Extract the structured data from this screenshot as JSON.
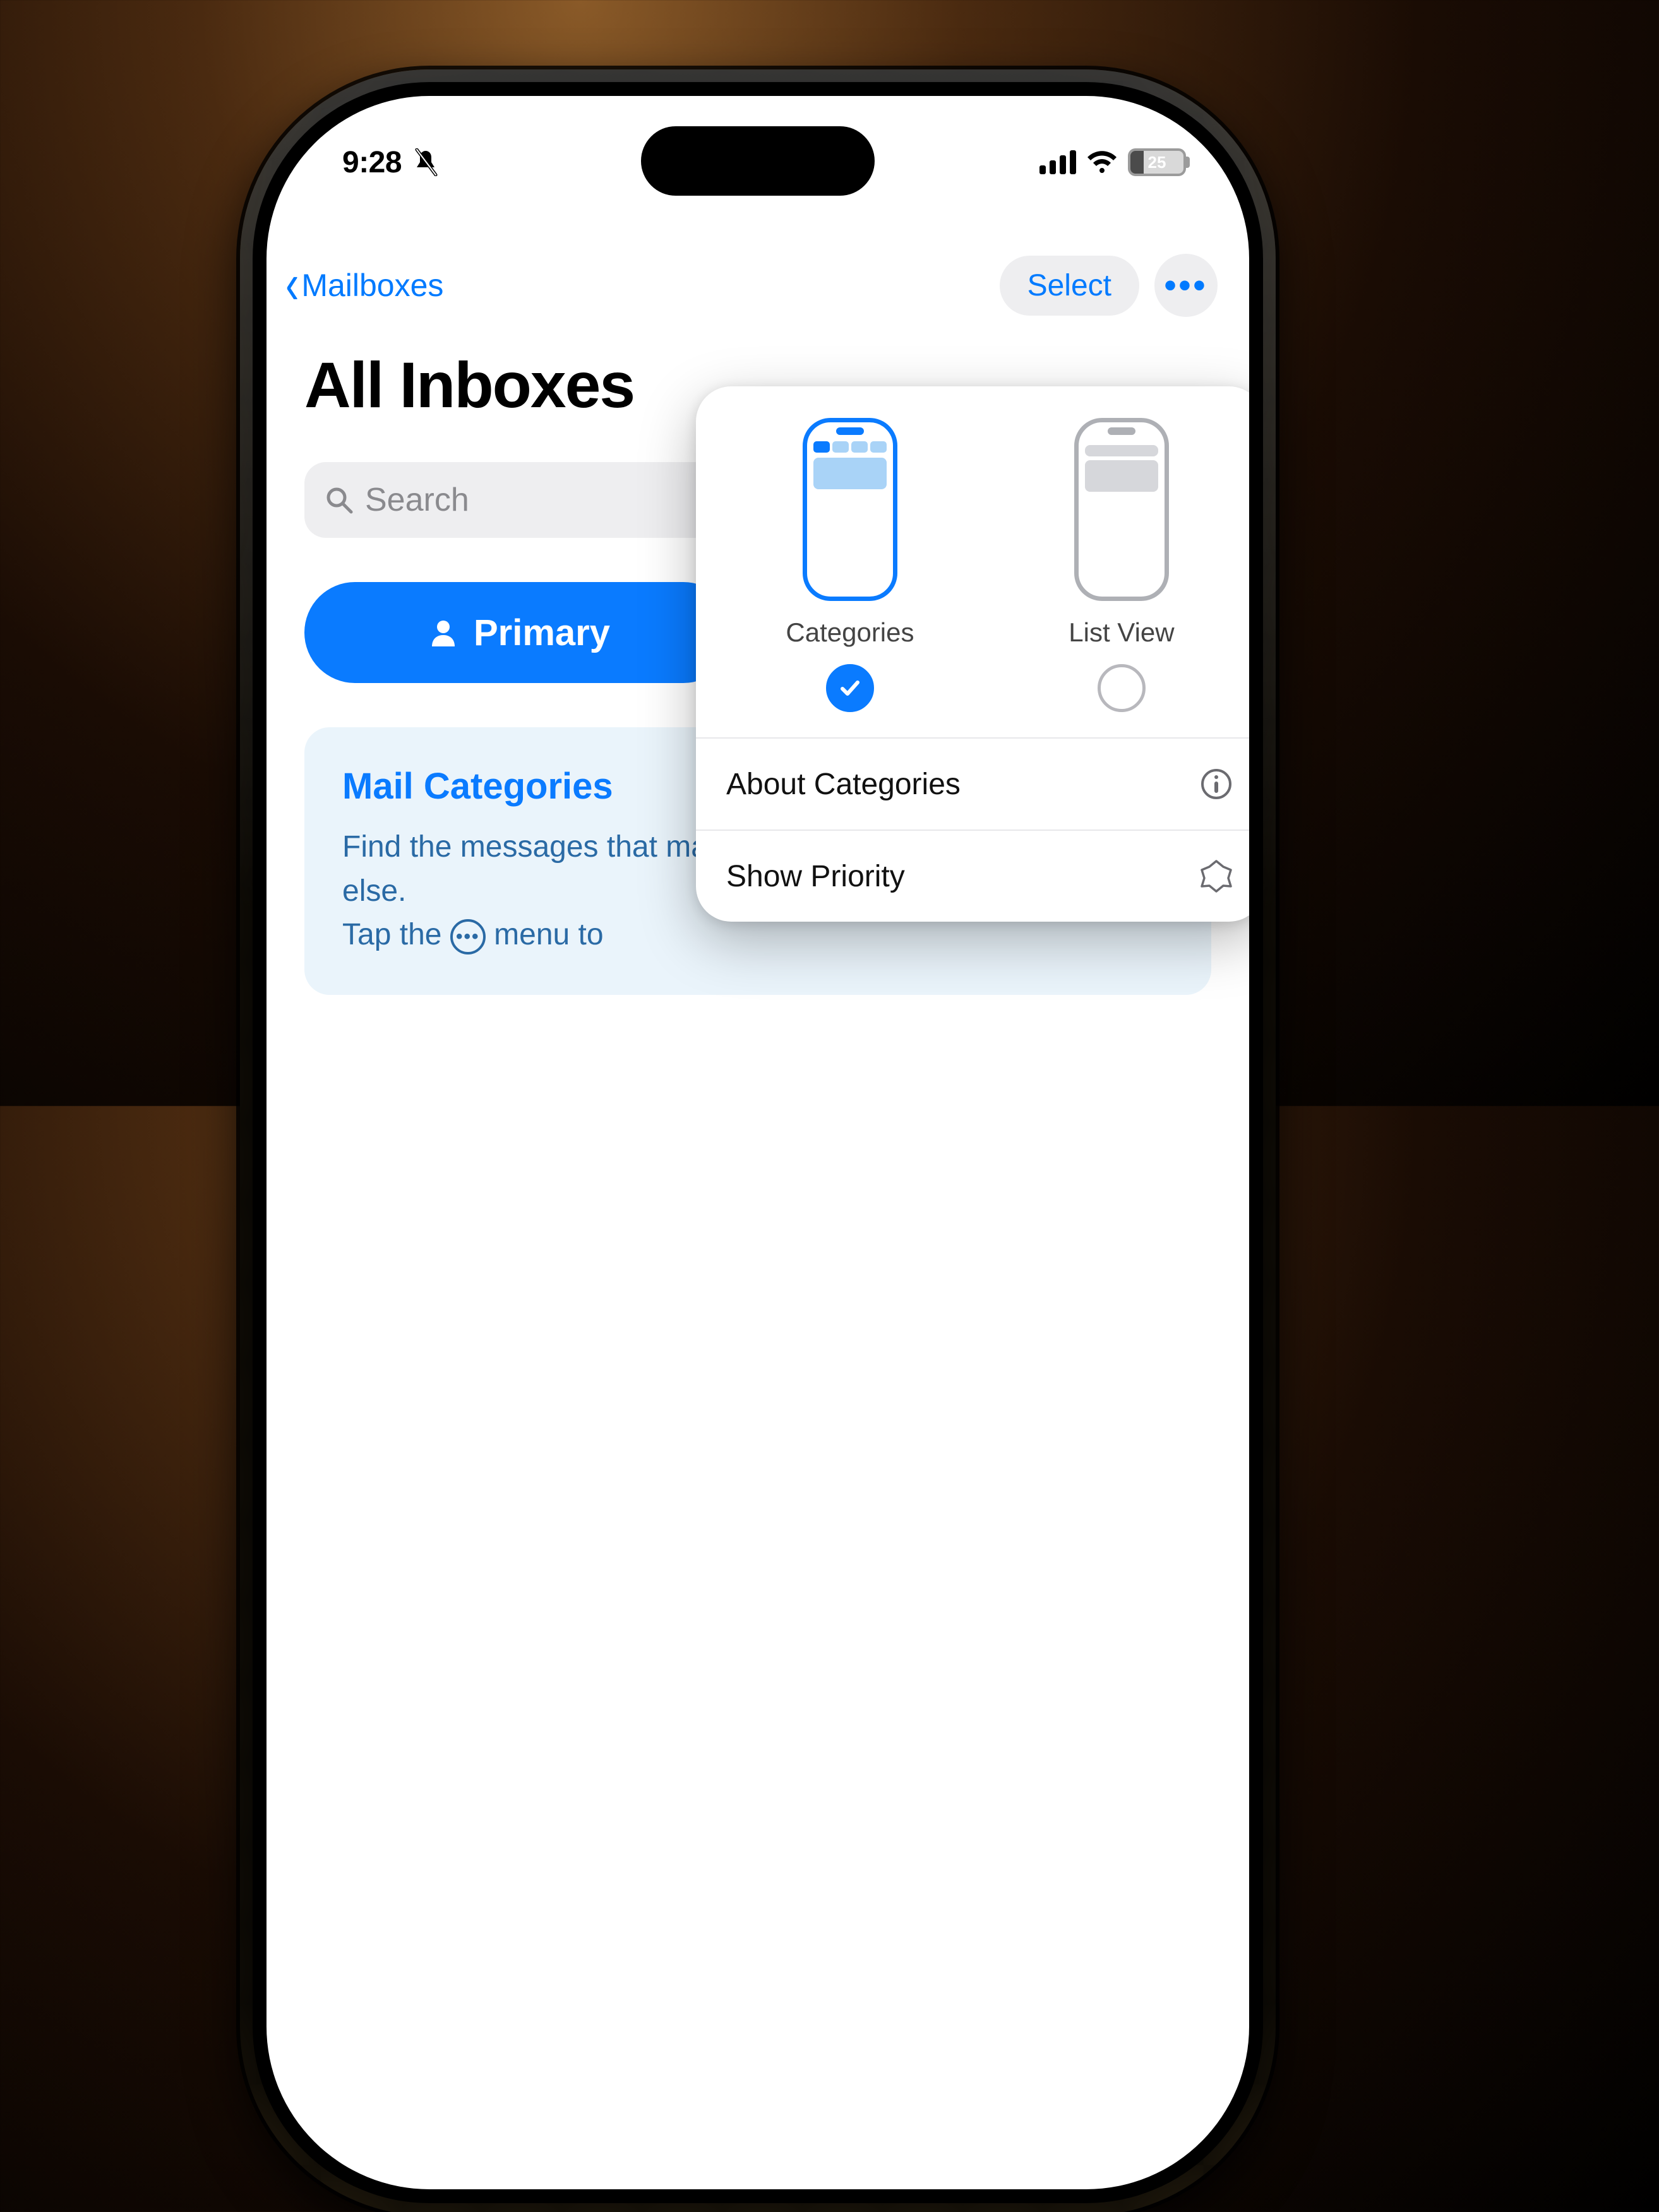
{
  "status": {
    "time": "9:28",
    "battery_pct": "25"
  },
  "nav": {
    "back_label": "Mailboxes",
    "select_label": "Select"
  },
  "title": "All Inboxes",
  "search": {
    "placeholder": "Search"
  },
  "primary_tab": {
    "label": "Primary"
  },
  "info": {
    "heading": "Mail Categories",
    "line1": "Find the messages that matter most and organize everything else.",
    "line2a": "Tap the ",
    "line2b": " menu to"
  },
  "popover": {
    "opt1": "Categories",
    "opt2": "List View",
    "row1": "About Categories",
    "row2": "Show Priority"
  }
}
